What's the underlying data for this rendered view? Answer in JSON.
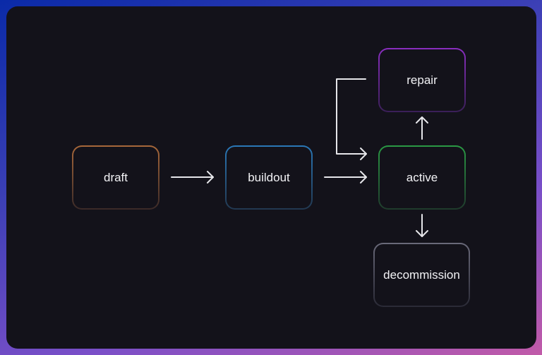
{
  "nodes": {
    "draft": {
      "label": "draft",
      "color_top": "#a8683a",
      "color_bottom": "#3a2a28"
    },
    "buildout": {
      "label": "buildout",
      "color_top": "#2a78b8",
      "color_bottom": "#223850"
    },
    "active": {
      "label": "active",
      "color_top": "#2a9a44",
      "color_bottom": "#1f3a2c"
    },
    "repair": {
      "label": "repair",
      "color_top": "#8a2ec0",
      "color_bottom": "#3a1f58"
    },
    "decommission": {
      "label": "decommission",
      "color_top": "#6a6a7a",
      "color_bottom": "#2a2a36"
    }
  },
  "edges": [
    {
      "from": "draft",
      "to": "buildout"
    },
    {
      "from": "buildout",
      "to": "active"
    },
    {
      "from": "active",
      "to": "repair"
    },
    {
      "from": "repair",
      "to": "active"
    },
    {
      "from": "active",
      "to": "decommission"
    }
  ],
  "edge_color": "#e6e6ea"
}
